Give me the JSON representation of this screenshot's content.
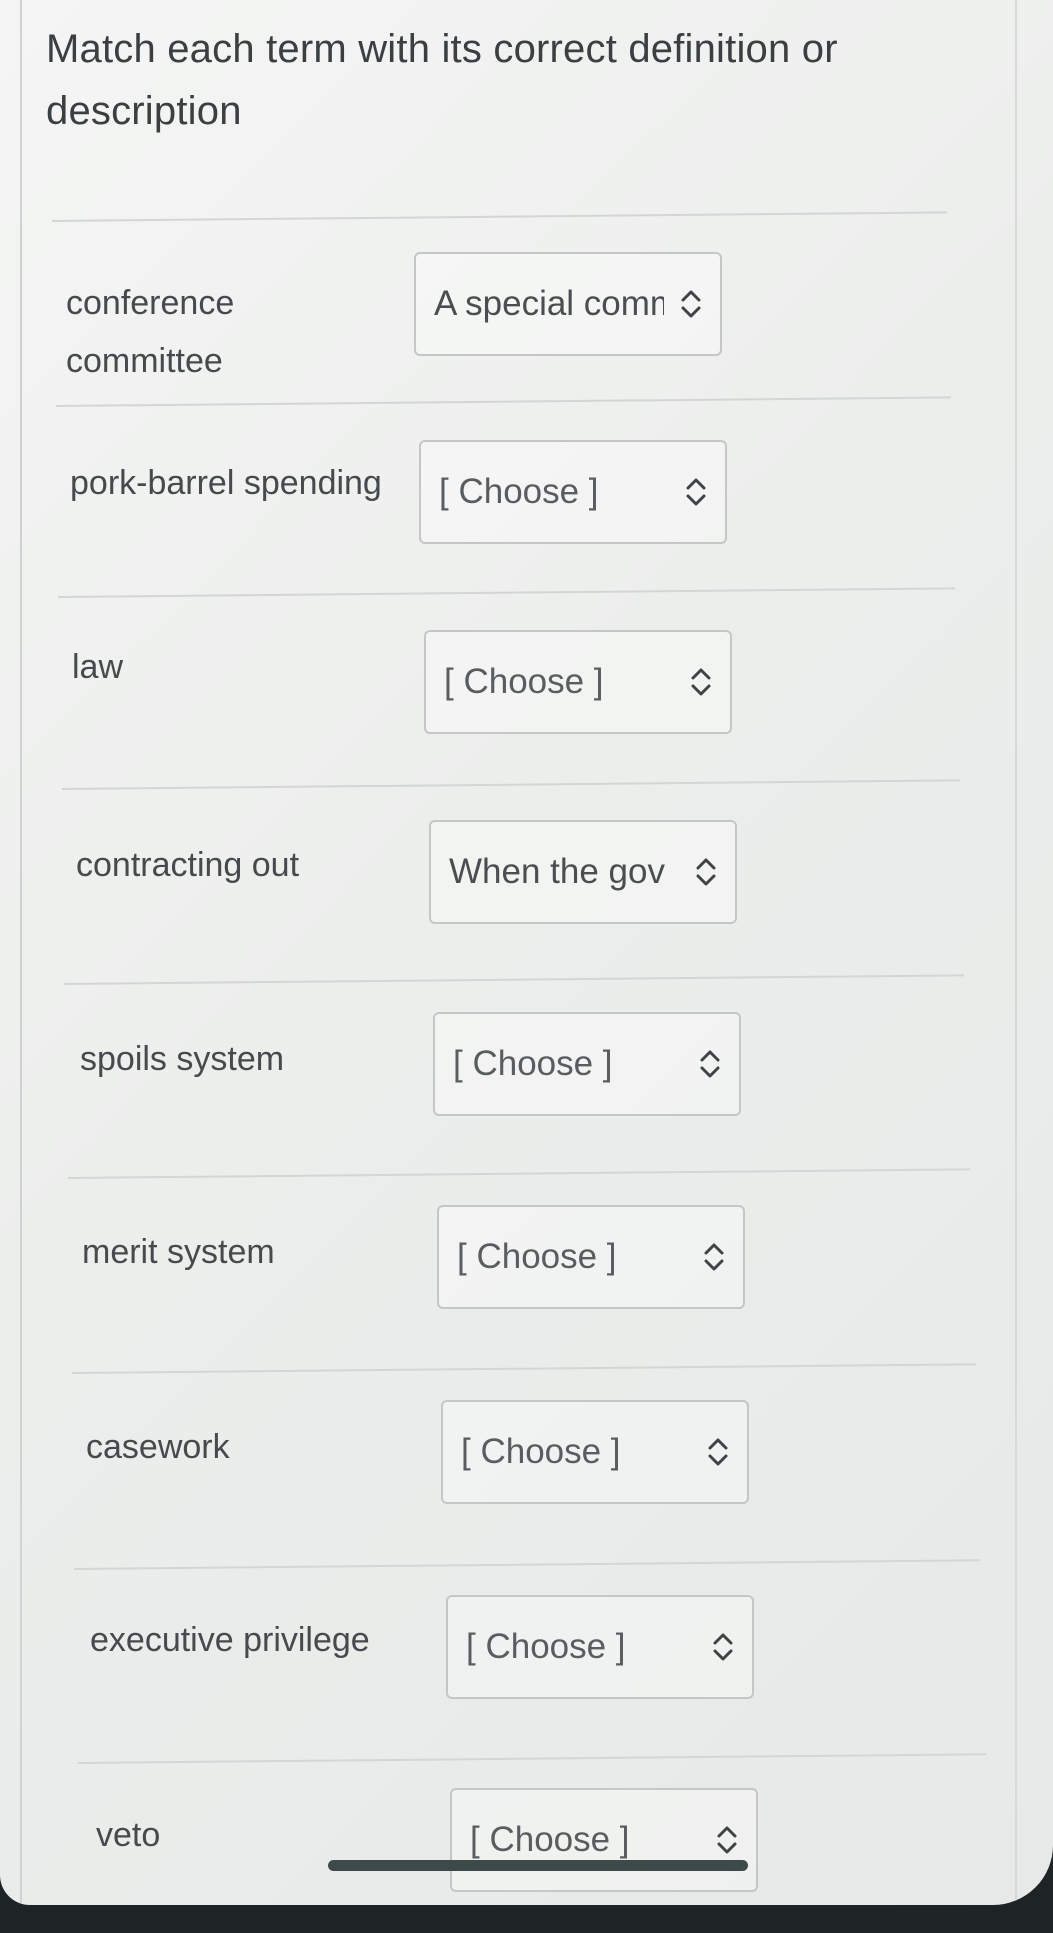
{
  "question": {
    "prompt": "Match each term with its correct definition or description"
  },
  "rows": [
    {
      "term": "conference committee",
      "selected": "A special committee"
    },
    {
      "term": "pork-barrel spending",
      "selected": "[ Choose ]"
    },
    {
      "term": "law",
      "selected": "[ Choose ]"
    },
    {
      "term": "contracting out",
      "selected": "When the gov"
    },
    {
      "term": "spoils system",
      "selected": "[ Choose ]"
    },
    {
      "term": "merit system",
      "selected": "[ Choose ]"
    },
    {
      "term": "casework",
      "selected": "[ Choose ]"
    },
    {
      "term": "executive privilege",
      "selected": "[ Choose ]"
    },
    {
      "term": "veto",
      "selected": "[ Choose ]"
    }
  ],
  "icons": {
    "select_arrow": "chevron-up-down-icon"
  },
  "colors": {
    "text": "#464a4d",
    "border": "#c4c7c6",
    "background": "#eef0ef"
  }
}
